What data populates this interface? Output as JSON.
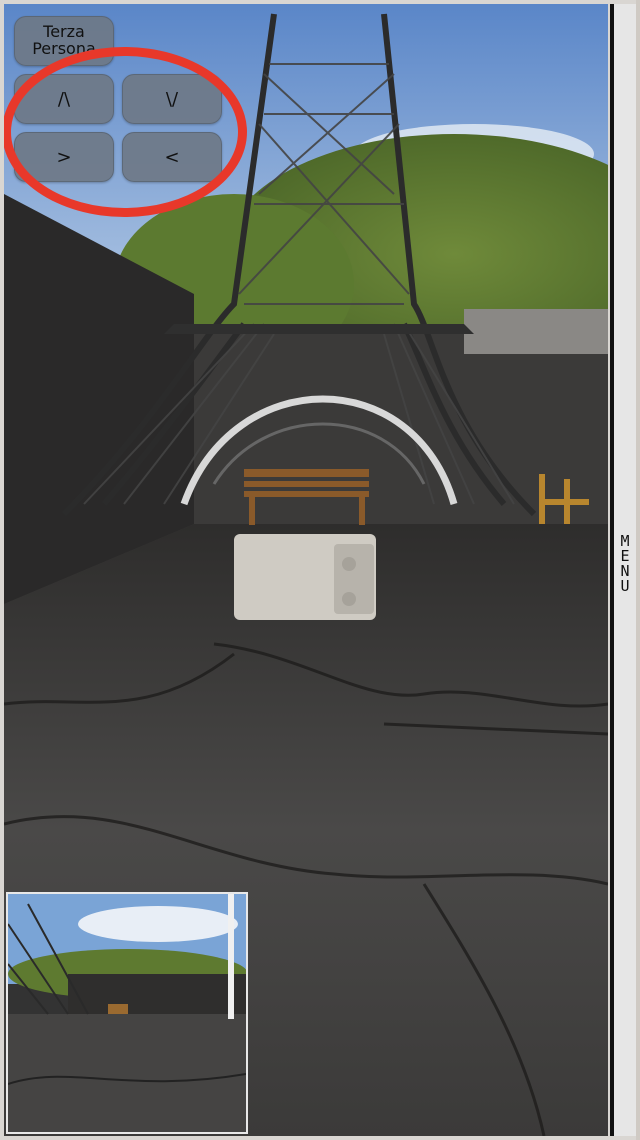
{
  "camera_toggle": {
    "label": "Terza Persona"
  },
  "controls": {
    "up_label": "/\\",
    "down_label": "\\/",
    "right_label": ">",
    "left_label": "<"
  },
  "menu": {
    "label": "MENU"
  },
  "colors": {
    "button_bg": "#6e7887",
    "highlight_ring": "#e8382a",
    "menu_bg": "#e6e6e6"
  },
  "icons": [
    "up-arrow-icon",
    "down-arrow-icon",
    "right-arrow-icon",
    "left-arrow-icon"
  ]
}
